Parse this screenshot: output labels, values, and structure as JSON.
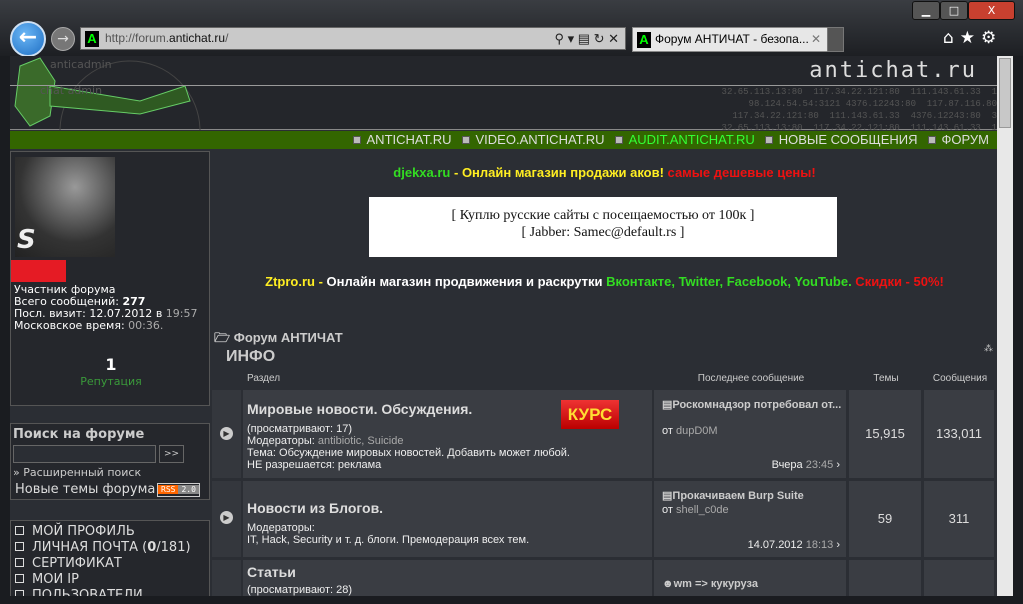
{
  "browser": {
    "url_prefix": "http://forum.",
    "url_domain": "antichat.ru",
    "url_suffix": "/",
    "tab_title": "Форум АНТИЧАТ - безопа...",
    "tab_close": "✕",
    "favicon": "A"
  },
  "header": {
    "logo": "antichat.ru",
    "ip_lines": "32.65.113.13:80  117.34.22.121:80  111.143.61.33  1\n98.124.54.54:3121 4376.12243:80  117.87.116.80\n117.34.22.121:80  111.143.61.33  4376.12243:80  3\n32.65.113.13:80  117.34.22.121:80  111.143.61.33  1"
  },
  "nav": [
    {
      "label": "ANTICHAT.RU",
      "color": "#dddddd"
    },
    {
      "label": "VIDEO.ANTICHAT.RU",
      "color": "#dddddd"
    },
    {
      "label": "AUDIT.ANTICHAT.RU",
      "color": "#33ff33"
    },
    {
      "label": "НОВЫЕ СООБЩЕНИЯ",
      "color": "#dddddd"
    },
    {
      "label": "ФОРУМ",
      "color": "#dddddd"
    }
  ],
  "profile": {
    "rank": "Участник форума",
    "posts_label": "Всего сообщений:",
    "posts": "277",
    "visit_label": "Посл. визит:",
    "visit_date": "12.07.2012",
    "visit_in": "в",
    "visit_time": "19:57",
    "msk_label": "Московское время:",
    "msk_time": "00:36.",
    "reputation": "1",
    "reputation_label": "Репутация",
    "avatar_letter": "S"
  },
  "search": {
    "title": "Поиск на форуме",
    "go": ">>",
    "advanced": "» Расширенный поиск",
    "new_topics": "Новые темы форума",
    "rss": "RSS",
    "rss_ver": "2.0"
  },
  "menu": [
    {
      "label": "МОЙ ПРОФИЛЬ"
    },
    {
      "label": "ЛИЧНАЯ ПОЧТА (",
      "bold": "0",
      "rest": "/181)"
    },
    {
      "label": "СЕРТИФИКАТ"
    },
    {
      "label": "МОИ IP"
    },
    {
      "label": "ПОЛЬЗОВАТЕЛИ"
    }
  ],
  "ads": {
    "a1_site": "djekxa.ru",
    "a1_dash": " - ",
    "a1_text": "Онлайн магазин продажи аков!",
    "a1_red": " самые дешевые цены!",
    "box_line1": "[ Куплю русские сайты с посещаемостью от 100к ]",
    "box_line2": "[ Jabber: Samec@default.rs ]",
    "a2_site": "Ztpro.ru",
    "a2_dash": " - ",
    "a2_text": "Онлайн магазин продвижения и раскрутки ",
    "a2_green": "Вконтакте, Twitter, Facebook, YouTube.",
    "a2_red": " Скидки - 50%!"
  },
  "forum": {
    "breadcrumb": "Форум АНТИЧАТ",
    "category": "ИНФО",
    "col_section": "Раздел",
    "col_last": "Последнее сообщение",
    "col_topics": "Темы",
    "col_posts": "Сообщения",
    "kurs": "КУРС",
    "rows": [
      {
        "title": "Мировые новости. Обсуждения.",
        "viewing": "(просматривают: 17)",
        "mods_label": "Модераторы:",
        "mods": "antibiotic, Suicide",
        "line3": "Тема: Обсуждение мировых новостей. Добавить может любой.",
        "line4": "НЕ разрешается: реклама",
        "last_title": "Роскомнадзор потребовал от...",
        "from": "от",
        "last_user": "dupD0M",
        "last_date": "Вчера",
        "last_time": "23:45",
        "topics": "15,915",
        "posts": "133,011"
      },
      {
        "title": "Новости из Блогов.",
        "mods_label": "Модераторы:",
        "line3": "IT, Hack, Security и т. д. блоги. Премодерация всех тем.",
        "last_title": "Прокачиваем Burp Suite",
        "from": "от",
        "last_user": "shell_c0de",
        "last_date": "14.07.2012",
        "last_time": "18:13",
        "topics": "59",
        "posts": "311"
      },
      {
        "title": "Статьи",
        "viewing": "(просматривают: 28)",
        "last_title": "wm => кукуруза"
      }
    ]
  }
}
